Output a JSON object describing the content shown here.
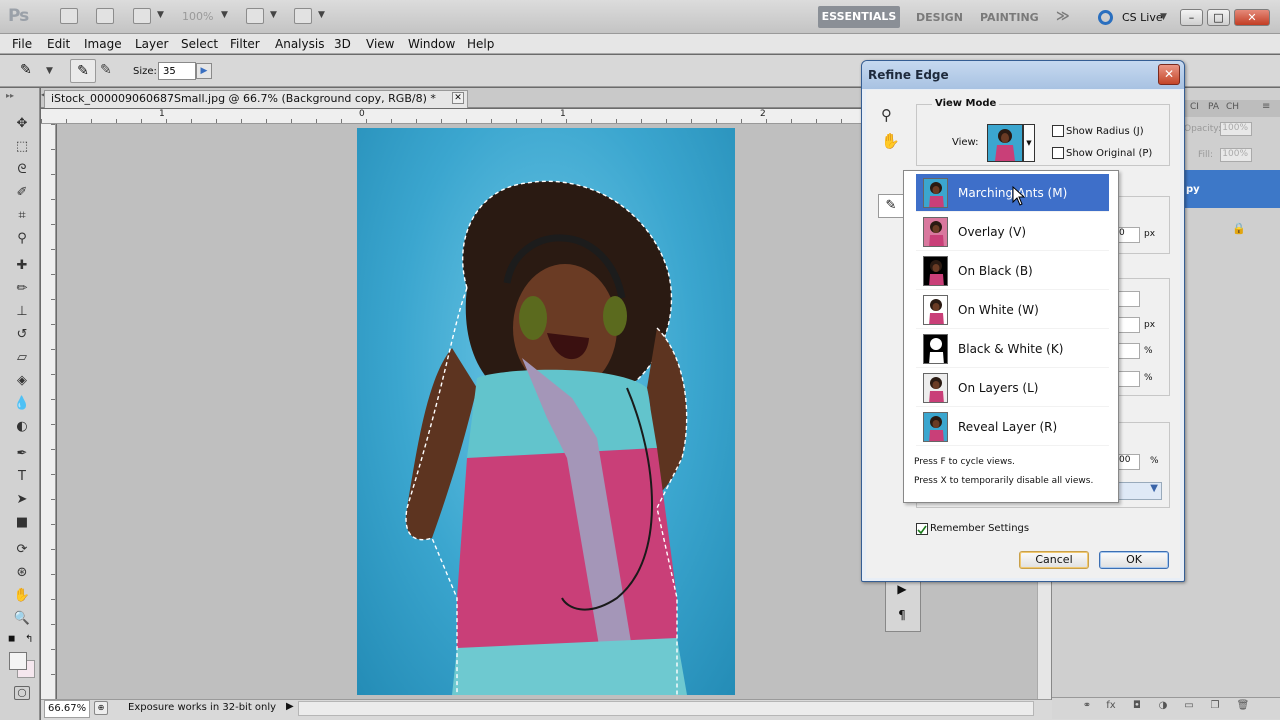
{
  "app": {
    "logo": "Ps",
    "zoom_level": "100%",
    "workspaces": [
      "ESSENTIALS",
      "DESIGN",
      "PAINTING"
    ],
    "more": "≫",
    "cs_live": "CS Live"
  },
  "menu": [
    "File",
    "Edit",
    "Image",
    "Layer",
    "Select",
    "Filter",
    "Analysis",
    "3D",
    "View",
    "Window",
    "Help"
  ],
  "options": {
    "size_label": "Size:",
    "size_value": "35"
  },
  "document": {
    "tab_title": "iStock_000009060687Small.jpg @ 66.7% (Background copy, RGB/8) *",
    "ruler_marks": [
      "1",
      "0",
      "1",
      "2"
    ],
    "zoom": "66.67%",
    "status": "Exposure works in 32-bit only"
  },
  "layers_panel": {
    "tabs": [
      "CI",
      "PA",
      "CH"
    ],
    "opacity_label": "Opacity:",
    "opacity_value": "100%",
    "fill_label": "Fill:",
    "fill_value": "100%",
    "layer_name_fragment": "py"
  },
  "refine_edge": {
    "title": "Refine Edge",
    "view_mode_legend": "View Mode",
    "view_label": "View:",
    "show_radius": "Show Radius (J)",
    "show_original": "Show Original (P)",
    "view_options": [
      {
        "label": "Marching Ants (M)",
        "selected": true,
        "bg": "#3ba6cf"
      },
      {
        "label": "Overlay (V)",
        "selected": false,
        "bg": "#d9789e"
      },
      {
        "label": "On Black (B)",
        "selected": false,
        "bg": "#000000"
      },
      {
        "label": "On White (W)",
        "selected": false,
        "bg": "#ffffff"
      },
      {
        "label": "Black & White (K)",
        "selected": false,
        "bg": "#000000"
      },
      {
        "label": "On Layers (L)",
        "selected": false,
        "bg": "#ededed"
      },
      {
        "label": "Reveal Layer (R)",
        "selected": false,
        "bg": "#3ba6cf"
      }
    ],
    "hint_cycle": "Press F to cycle views.",
    "hint_disable": "Press X to temporarily disable all views.",
    "ghost_units": [
      "px",
      "px",
      "%",
      "%",
      "%"
    ],
    "ghost_value": "0",
    "ghost_value2": "00",
    "remember_label": "Remember Settings",
    "remember_checked": true,
    "cancel_label": "Cancel",
    "ok_label": "OK"
  },
  "colors": {
    "accent": "#3e6fc9",
    "photo_bg": "#3ba6cf"
  }
}
